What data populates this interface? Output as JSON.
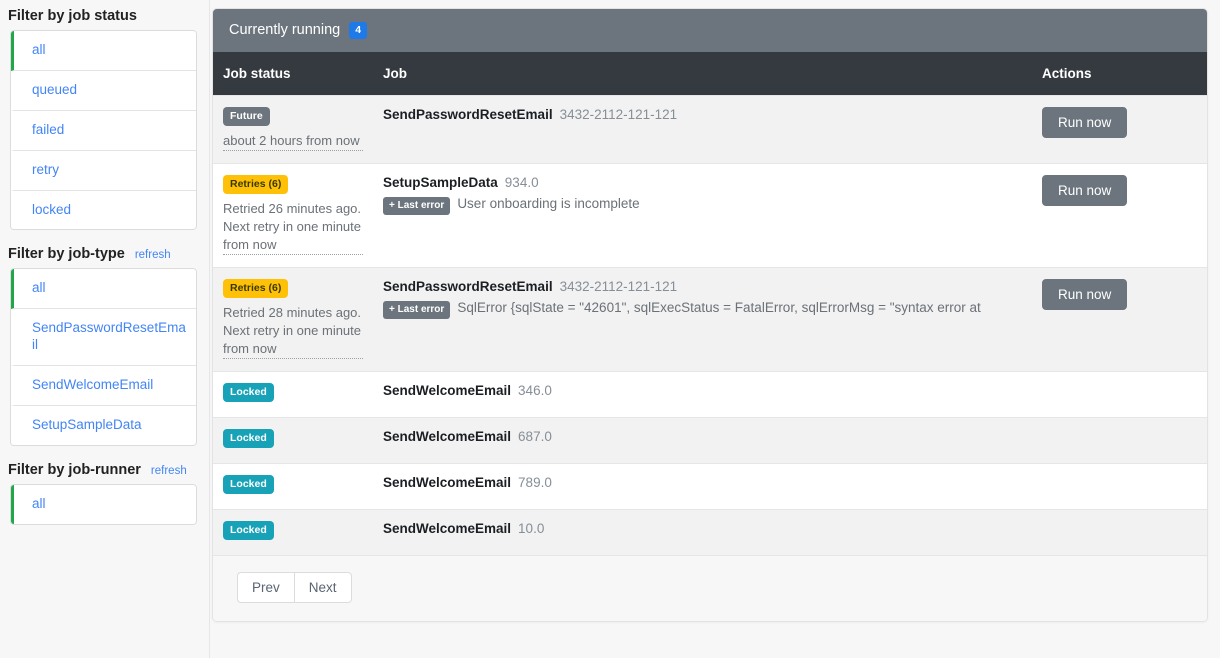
{
  "sidebar": {
    "groups": [
      {
        "title": "Filter by job status",
        "refresh_label": "",
        "items": [
          {
            "label": "all",
            "active": true
          },
          {
            "label": "queued",
            "active": false
          },
          {
            "label": "failed",
            "active": false
          },
          {
            "label": "retry",
            "active": false
          },
          {
            "label": "locked",
            "active": false
          }
        ]
      },
      {
        "title": "Filter by job-type",
        "refresh_label": "refresh",
        "items": [
          {
            "label": "all",
            "active": true
          },
          {
            "label": "SendPasswordResetEmail",
            "active": false
          },
          {
            "label": "SendWelcomeEmail",
            "active": false
          },
          {
            "label": "SetupSampleData",
            "active": false
          }
        ]
      },
      {
        "title": "Filter by job-runner",
        "refresh_label": "refresh",
        "items": [
          {
            "label": "all",
            "active": true
          }
        ]
      }
    ]
  },
  "panel": {
    "header_title": "Currently running",
    "header_count": "4",
    "columns": {
      "status": "Job status",
      "job": "Job",
      "actions": "Actions"
    },
    "rows": [
      {
        "badge": "Future",
        "badge_kind": "future",
        "time_text": "about 2 hours from now",
        "job_name": "SendPasswordResetEmail",
        "job_id": "3432-2112-121-121",
        "error_toggle": "",
        "error_text": "",
        "action_label": "Run now",
        "has_action": true
      },
      {
        "badge": "Retries (6)",
        "badge_kind": "retries",
        "time_text": "Retried 26 minutes ago. Next retry in one minute from now",
        "job_name": "SetupSampleData",
        "job_id": "934.0",
        "error_toggle": "+ Last error",
        "error_text": "User onboarding is incomplete",
        "action_label": "Run now",
        "has_action": true
      },
      {
        "badge": "Retries (6)",
        "badge_kind": "retries",
        "time_text": "Retried 28 minutes ago. Next retry in one minute from now",
        "job_name": "SendPasswordResetEmail",
        "job_id": "3432-2112-121-121",
        "error_toggle": "+ Last error",
        "error_text": "SqlError {sqlState = \"42601\", sqlExecStatus = FatalError, sqlErrorMsg = \"syntax error at",
        "action_label": "Run now",
        "has_action": true
      },
      {
        "badge": "Locked",
        "badge_kind": "locked",
        "time_text": "",
        "job_name": "SendWelcomeEmail",
        "job_id": "346.0",
        "error_toggle": "",
        "error_text": "",
        "action_label": "",
        "has_action": false
      },
      {
        "badge": "Locked",
        "badge_kind": "locked",
        "time_text": "",
        "job_name": "SendWelcomeEmail",
        "job_id": "687.0",
        "error_toggle": "",
        "error_text": "",
        "action_label": "",
        "has_action": false
      },
      {
        "badge": "Locked",
        "badge_kind": "locked",
        "time_text": "",
        "job_name": "SendWelcomeEmail",
        "job_id": "789.0",
        "error_toggle": "",
        "error_text": "",
        "action_label": "",
        "has_action": false
      },
      {
        "badge": "Locked",
        "badge_kind": "locked",
        "time_text": "",
        "job_name": "SendWelcomeEmail",
        "job_id": "10.0",
        "error_toggle": "",
        "error_text": "",
        "action_label": "",
        "has_action": false
      }
    ],
    "pager": {
      "prev_label": "Prev",
      "next_label": "Next"
    }
  },
  "colors": {
    "accent_link": "#4285f4",
    "active_border": "#1fa74a",
    "badge_count": "#1e7ae8",
    "badge_future": "#6c757d",
    "badge_retries": "#ffc107",
    "badge_locked": "#17a2b8",
    "header_bar": "#6c757d",
    "table_header": "#343a40"
  }
}
